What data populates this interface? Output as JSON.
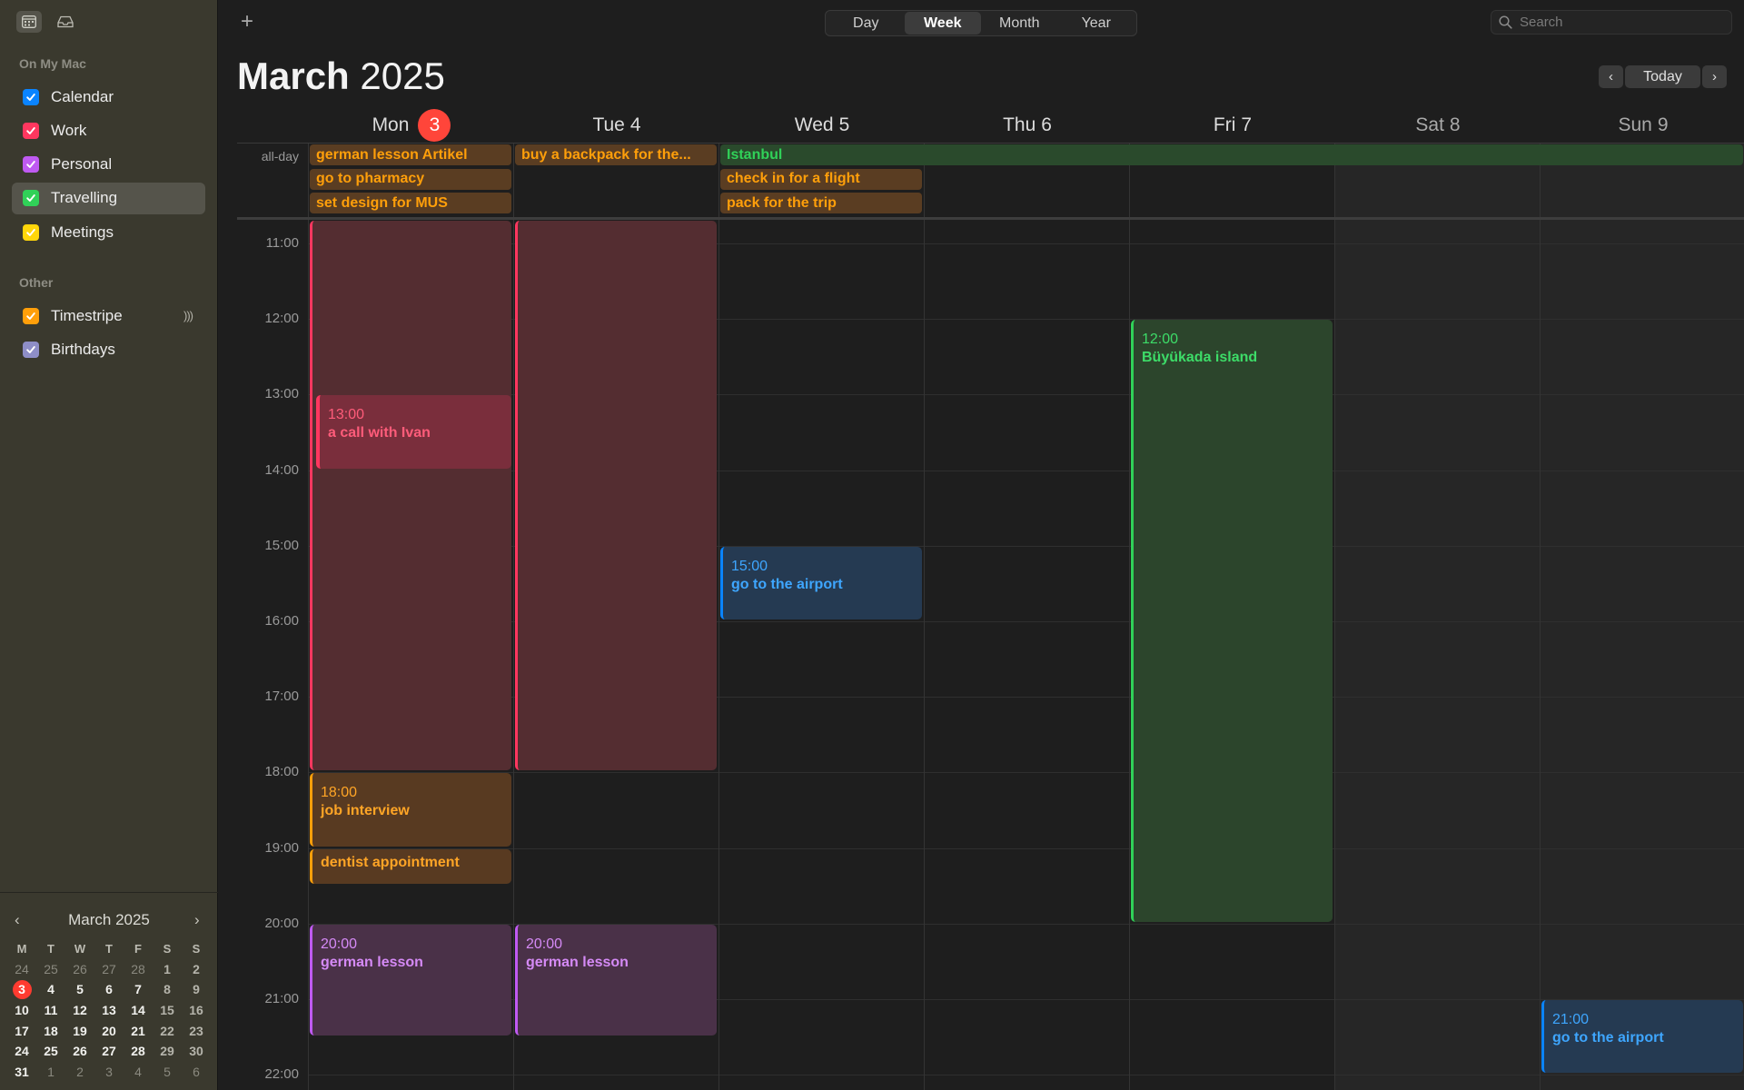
{
  "sidebar": {
    "section_mac": "On My Mac",
    "calendars": [
      {
        "label": "Calendar",
        "color": "#0a84ff"
      },
      {
        "label": "Work",
        "color": "#ff375f"
      },
      {
        "label": "Personal",
        "color": "#bf5af2"
      },
      {
        "label": "Travelling",
        "color": "#30d158"
      },
      {
        "label": "Meetings",
        "color": "#ffd60a"
      }
    ],
    "section_other": "Other",
    "other_calendars": [
      {
        "label": "Timestripe",
        "color": "#ff9f0a"
      },
      {
        "label": "Birthdays",
        "color": "#8e8ec7"
      }
    ],
    "selected": "Travelling"
  },
  "mini_calendar": {
    "title": "March 2025",
    "weekday_headers": [
      "M",
      "T",
      "W",
      "T",
      "F",
      "S",
      "S"
    ],
    "weeks": [
      [
        "24",
        "25",
        "26",
        "27",
        "28",
        "1",
        "2"
      ],
      [
        "3",
        "4",
        "5",
        "6",
        "7",
        "8",
        "9"
      ],
      [
        "10",
        "11",
        "12",
        "13",
        "14",
        "15",
        "16"
      ],
      [
        "17",
        "18",
        "19",
        "20",
        "21",
        "22",
        "23"
      ],
      [
        "24",
        "25",
        "26",
        "27",
        "28",
        "29",
        "30"
      ],
      [
        "31",
        "1",
        "2",
        "3",
        "4",
        "5",
        "6"
      ]
    ],
    "today": "3"
  },
  "toolbar": {
    "views": [
      "Day",
      "Week",
      "Month",
      "Year"
    ],
    "active_view": "Week",
    "search_placeholder": "Search",
    "today_label": "Today"
  },
  "header": {
    "month": "March",
    "year": "2025"
  },
  "days": [
    {
      "label": "Mon",
      "num": "3",
      "today": true
    },
    {
      "label": "Tue",
      "num": "4"
    },
    {
      "label": "Wed",
      "num": "5"
    },
    {
      "label": "Thu",
      "num": "6"
    },
    {
      "label": "Fri",
      "num": "7"
    },
    {
      "label": "Sat",
      "num": "8",
      "weekend": true
    },
    {
      "label": "Sun",
      "num": "9",
      "weekend": true
    }
  ],
  "allday_label": "all-day",
  "hours": [
    "11:00",
    "12:00",
    "13:00",
    "14:00",
    "15:00",
    "16:00",
    "17:00",
    "18:00",
    "19:00",
    "20:00",
    "21:00",
    "22:00"
  ],
  "allday_events": [
    {
      "day": 0,
      "row": 0,
      "title": "german lesson Artikel",
      "color": "orange"
    },
    {
      "day": 0,
      "row": 1,
      "title": "go to pharmacy",
      "color": "orange"
    },
    {
      "day": 0,
      "row": 2,
      "title": "set design for MUS",
      "color": "orange"
    },
    {
      "day": 1,
      "row": 0,
      "title": "buy a backpack for the...",
      "color": "orange"
    },
    {
      "day": 2,
      "row": 0,
      "title": "Istanbul",
      "color": "green",
      "span": 5
    },
    {
      "day": 2,
      "row": 1,
      "title": "check in for a flight",
      "color": "orange"
    },
    {
      "day": 2,
      "row": 2,
      "title": "pack for the trip",
      "color": "orange"
    }
  ],
  "events": [
    {
      "day": 0,
      "start": 10.68,
      "end": 18.0,
      "time": "",
      "title": "",
      "style": "pinkbar"
    },
    {
      "day": 1,
      "start": 10.68,
      "end": 18.0,
      "time": "",
      "title": "",
      "style": "pinkbar"
    },
    {
      "day": 0,
      "start": 13.0,
      "end": 14.0,
      "time": "13:00",
      "title": "a call with Ivan",
      "style": "pink",
      "inset": true
    },
    {
      "day": 0,
      "start": 18.0,
      "end": 19.0,
      "time": "18:00",
      "title": "job interview",
      "style": "orange"
    },
    {
      "day": 0,
      "start": 19.0,
      "end": 19.5,
      "time": "",
      "title": "dentist appointment",
      "style": "orange",
      "short": true
    },
    {
      "day": 0,
      "start": 20.0,
      "end": 21.5,
      "time": "20:00",
      "title": "german lesson",
      "style": "purple"
    },
    {
      "day": 1,
      "start": 20.0,
      "end": 21.5,
      "time": "20:00",
      "title": "german lesson",
      "style": "purple"
    },
    {
      "day": 2,
      "start": 15.0,
      "end": 16.0,
      "time": "15:00",
      "title": "go to the airport",
      "style": "blue"
    },
    {
      "day": 4,
      "start": 12.0,
      "end": 20.0,
      "time": "12:00",
      "title": "Büyükada island",
      "style": "green"
    },
    {
      "day": 6,
      "start": 21.0,
      "end": 22.0,
      "time": "21:00",
      "title": "go to the airport",
      "style": "blue"
    }
  ]
}
